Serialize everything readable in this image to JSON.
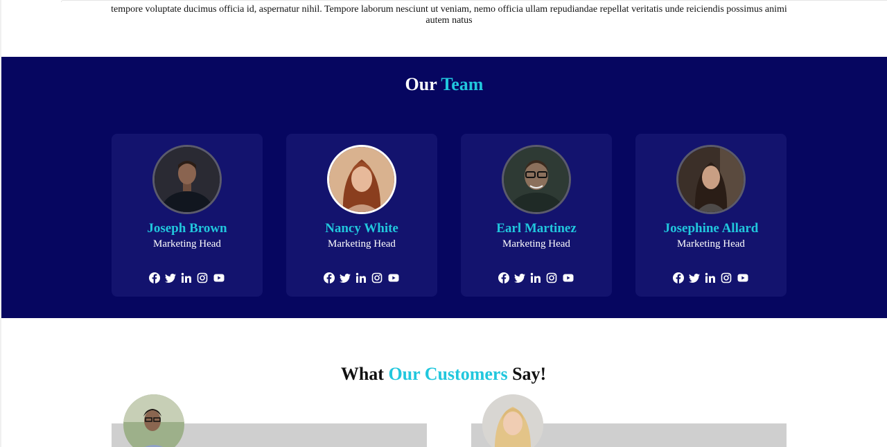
{
  "intro": {
    "text": "tempore voluptate ducimus officia id, aspernatur nihil. Tempore laborum nesciunt ut veniam, nemo officia ullam repudiandae repellat veritatis unde reiciendis possimus animi autem natus"
  },
  "team": {
    "title_prefix": "Our",
    "title_accent": "Team",
    "members": [
      {
        "name": "Joseph Brown",
        "role": "Marketing Head"
      },
      {
        "name": "Nancy White",
        "role": "Marketing Head"
      },
      {
        "name": "Earl Martinez",
        "role": "Marketing Head"
      },
      {
        "name": "Josephine Allard",
        "role": "Marketing Head"
      }
    ],
    "social_icons": [
      "facebook-icon",
      "twitter-icon",
      "linkedin-icon",
      "instagram-icon",
      "youtube-icon"
    ]
  },
  "customers": {
    "title_prefix": "What",
    "title_accent": "Our Customers",
    "title_suffix": "Say!"
  },
  "colors": {
    "team_bg": "#060660",
    "card_bg": "#13136e",
    "accent": "#21c7dd",
    "testimonial_bg": "#cfcfcf"
  }
}
